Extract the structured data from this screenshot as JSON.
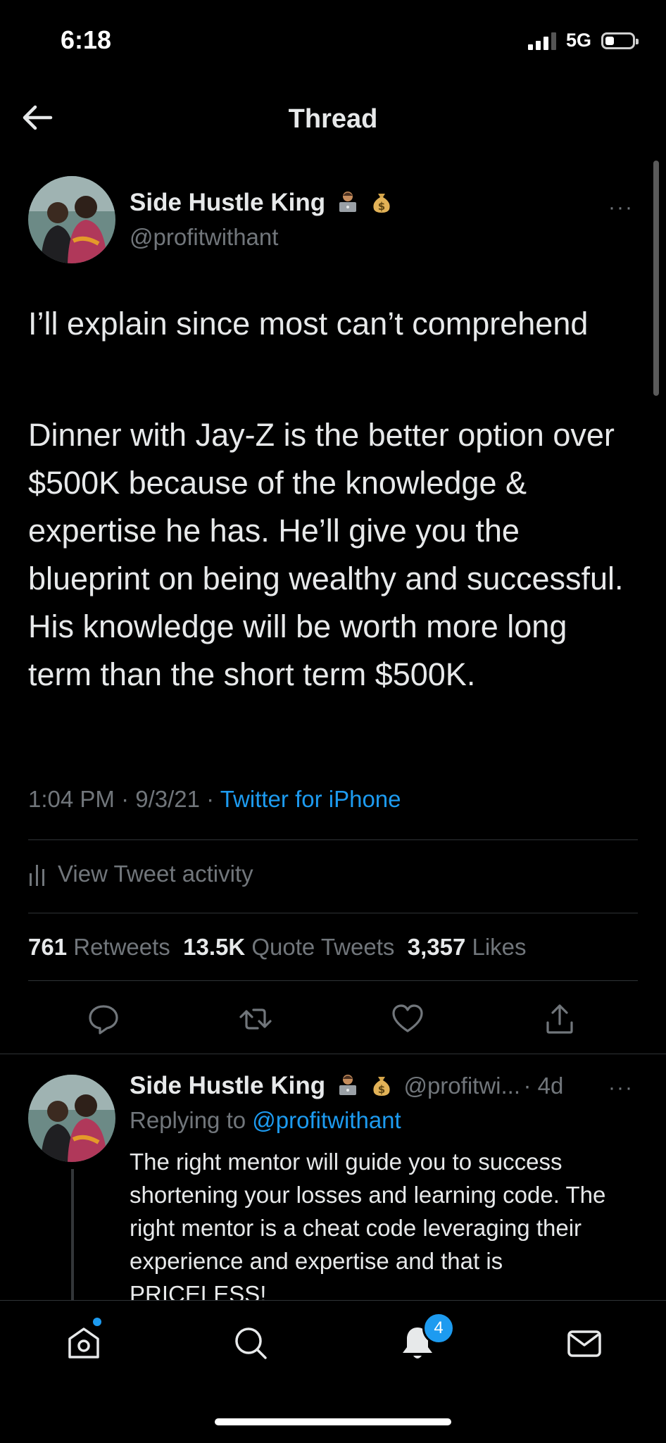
{
  "status_bar": {
    "time": "6:18",
    "network": "5G",
    "battery_level": 0.25
  },
  "header": {
    "title": "Thread"
  },
  "tweet": {
    "author_name": "Side Hustle King",
    "author_emojis": [
      "technologist-emoji",
      "money-bag-emoji"
    ],
    "handle": "@profitwithant",
    "paragraphs": [
      "I’ll explain since most can’t comprehend",
      "Dinner with Jay-Z is the better option over $500K because of the knowledge & expertise he has. He’ll give you the blueprint on being wealthy and successful. His knowledge will be worth more long term than the short term $500K."
    ],
    "time": "1:04 PM",
    "date": "9/3/21",
    "source": "Twitter for iPhone",
    "activity_label": "View Tweet activity",
    "retweets_count": "761",
    "retweets_label": "Retweets",
    "quotes_count": "13.5K",
    "quotes_label": "Quote Tweets",
    "likes_count": "3,357",
    "likes_label": "Likes",
    "more": "···"
  },
  "reply": {
    "author_name": "Side Hustle King",
    "handle": "@profitwi...",
    "age": "4d",
    "replying_prefix": "Replying to",
    "replying_handle": "@profitwithant",
    "text": "The right mentor will guide you to success shortening your losses and learning code. The right mentor is a cheat code leveraging their experience and expertise and that is PRICELESS!",
    "more": "···"
  },
  "tab_bar": {
    "items": [
      "home-icon",
      "search-icon",
      "notifications-icon",
      "messages-icon"
    ],
    "notifications_badge": "4"
  },
  "colors": {
    "background": "#000000",
    "text": "#e7e9ea",
    "muted": "#71767b",
    "accent": "#1d9bf0"
  }
}
